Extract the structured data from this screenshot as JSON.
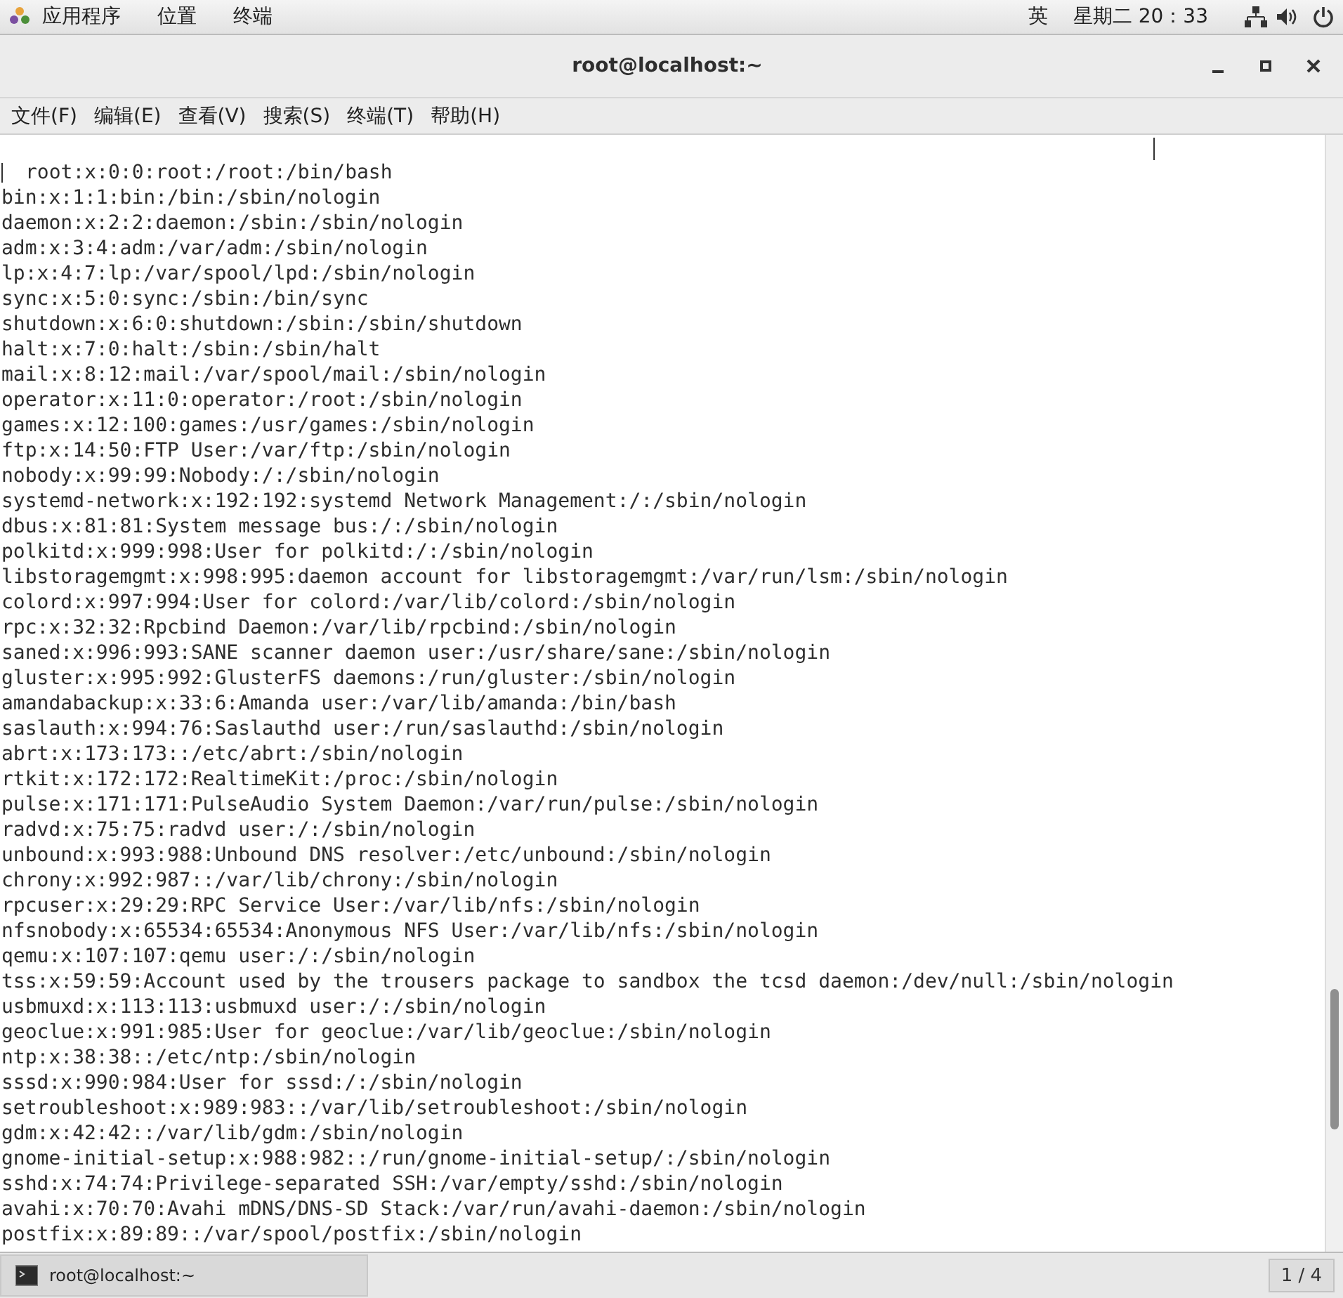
{
  "top_bar": {
    "menus": [
      "应用程序",
      "位置",
      "终端"
    ],
    "input_method": "英",
    "clock": "星期二 20：33"
  },
  "window": {
    "title": "root@localhost:~"
  },
  "menu_bar": [
    "文件(F)",
    "编辑(E)",
    "查看(V)",
    "搜索(S)",
    "终端(T)",
    "帮助(H)"
  ],
  "terminal": {
    "lines": [
      "root:x:0:0:root:/root:/bin/bash",
      "bin:x:1:1:bin:/bin:/sbin/nologin",
      "daemon:x:2:2:daemon:/sbin:/sbin/nologin",
      "adm:x:3:4:adm:/var/adm:/sbin/nologin",
      "lp:x:4:7:lp:/var/spool/lpd:/sbin/nologin",
      "sync:x:5:0:sync:/sbin:/bin/sync",
      "shutdown:x:6:0:shutdown:/sbin:/sbin/shutdown",
      "halt:x:7:0:halt:/sbin:/sbin/halt",
      "mail:x:8:12:mail:/var/spool/mail:/sbin/nologin",
      "operator:x:11:0:operator:/root:/sbin/nologin",
      "games:x:12:100:games:/usr/games:/sbin/nologin",
      "ftp:x:14:50:FTP User:/var/ftp:/sbin/nologin",
      "nobody:x:99:99:Nobody:/:/sbin/nologin",
      "systemd-network:x:192:192:systemd Network Management:/:/sbin/nologin",
      "dbus:x:81:81:System message bus:/:/sbin/nologin",
      "polkitd:x:999:998:User for polkitd:/:/sbin/nologin",
      "libstoragemgmt:x:998:995:daemon account for libstoragemgmt:/var/run/lsm:/sbin/nologin",
      "colord:x:997:994:User for colord:/var/lib/colord:/sbin/nologin",
      "rpc:x:32:32:Rpcbind Daemon:/var/lib/rpcbind:/sbin/nologin",
      "saned:x:996:993:SANE scanner daemon user:/usr/share/sane:/sbin/nologin",
      "gluster:x:995:992:GlusterFS daemons:/run/gluster:/sbin/nologin",
      "amandabackup:x:33:6:Amanda user:/var/lib/amanda:/bin/bash",
      "saslauth:x:994:76:Saslauthd user:/run/saslauthd:/sbin/nologin",
      "abrt:x:173:173::/etc/abrt:/sbin/nologin",
      "rtkit:x:172:172:RealtimeKit:/proc:/sbin/nologin",
      "pulse:x:171:171:PulseAudio System Daemon:/var/run/pulse:/sbin/nologin",
      "radvd:x:75:75:radvd user:/:/sbin/nologin",
      "unbound:x:993:988:Unbound DNS resolver:/etc/unbound:/sbin/nologin",
      "chrony:x:992:987::/var/lib/chrony:/sbin/nologin",
      "rpcuser:x:29:29:RPC Service User:/var/lib/nfs:/sbin/nologin",
      "nfsnobody:x:65534:65534:Anonymous NFS User:/var/lib/nfs:/sbin/nologin",
      "qemu:x:107:107:qemu user:/:/sbin/nologin",
      "tss:x:59:59:Account used by the trousers package to sandbox the tcsd daemon:/dev/null:/sbin/nologin",
      "usbmuxd:x:113:113:usbmuxd user:/:/sbin/nologin",
      "geoclue:x:991:985:User for geoclue:/var/lib/geoclue:/sbin/nologin",
      "ntp:x:38:38::/etc/ntp:/sbin/nologin",
      "sssd:x:990:984:User for sssd:/:/sbin/nologin",
      "setroubleshoot:x:989:983::/var/lib/setroubleshoot:/sbin/nologin",
      "gdm:x:42:42::/var/lib/gdm:/sbin/nologin",
      "gnome-initial-setup:x:988:982::/run/gnome-initial-setup/:/sbin/nologin",
      "sshd:x:74:74:Privilege-separated SSH:/var/empty/sshd:/sbin/nologin",
      "avahi:x:70:70:Avahi mDNS/DNS-SD Stack:/var/run/avahi-daemon:/sbin/nologin",
      "postfix:x:89:89::/var/spool/postfix:/sbin/nologin"
    ]
  },
  "taskbar": {
    "items": [
      {
        "label": "root@localhost:~",
        "selected": true
      }
    ],
    "workspace": "1 / 4"
  }
}
